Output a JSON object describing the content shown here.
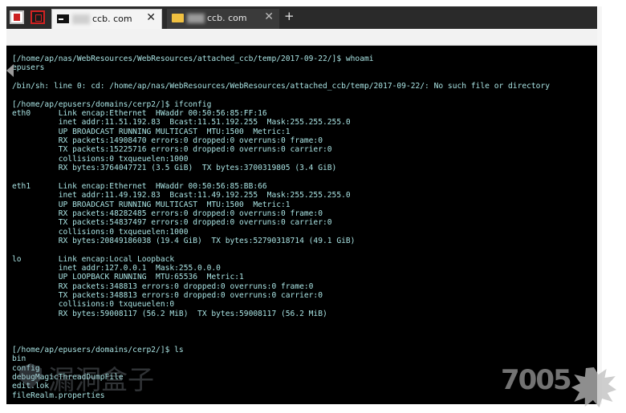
{
  "tabs": [
    {
      "domain": "ccb. com",
      "close": "✕",
      "active": true
    },
    {
      "domain": "ccb. com",
      "close": "✕",
      "active": false
    }
  ],
  "new_tab": "+",
  "terminal": {
    "lines": [
      "[/home/ap/nas/WebResources/WebResources/attached_ccb/temp/2017-09-22/]$ whoami",
      "epusers",
      "",
      "/bin/sh: line 0: cd: /home/ap/nas/WebResources/WebResources/attached_ccb/temp/2017-09-22/: No such file or directory",
      "",
      "[/home/ap/epusers/domains/cerp2/]$ ifconfig",
      "eth0      Link encap:Ethernet  HWaddr 00:50:56:85:FF:16",
      "          inet addr:11.51.192.83  Bcast:11.51.192.255  Mask:255.255.255.0",
      "          UP BROADCAST RUNNING MULTICAST  MTU:1500  Metric:1",
      "          RX packets:14908470 errors:0 dropped:0 overruns:0 frame:0",
      "          TX packets:15225716 errors:0 dropped:0 overruns:0 carrier:0",
      "          collisions:0 txqueuelen:1000",
      "          RX bytes:3764047721 (3.5 GiB)  TX bytes:3700319805 (3.4 GiB)",
      "",
      "eth1      Link encap:Ethernet  HWaddr 00:50:56:85:BB:66",
      "          inet addr:11.49.192.83  Bcast:11.49.192.255  Mask:255.255.255.0",
      "          UP BROADCAST RUNNING MULTICAST  MTU:1500  Metric:1",
      "          RX packets:48282485 errors:0 dropped:0 overruns:0 frame:0",
      "          TX packets:54837497 errors:0 dropped:0 overruns:0 carrier:0",
      "          collisions:0 txqueuelen:1000",
      "          RX bytes:20849186038 (19.4 GiB)  TX bytes:52790318714 (49.1 GiB)",
      "",
      "lo        Link encap:Local Loopback",
      "          inet addr:127.0.0.1  Mask:255.0.0.0",
      "          UP LOOPBACK RUNNING  MTU:65536  Metric:1",
      "          RX packets:348813 errors:0 dropped:0 overruns:0 frame:0",
      "          TX packets:348813 errors:0 dropped:0 overruns:0 carrier:0",
      "          collisions:0 txqueuelen:0",
      "          RX bytes:59008117 (56.2 MiB)  TX bytes:59008117 (56.2 MiB)",
      "",
      "",
      "",
      "[/home/ap/epusers/domains/cerp2/]$ ls",
      "bin",
      "config",
      "debugMagicThreadDumpFile",
      "edit.lok",
      "fileRealm.properties"
    ]
  },
  "watermarks": {
    "left": "漏洞盒子",
    "right": "7005"
  },
  "colors": {
    "terminal_bg": "#000000",
    "terminal_fg": "#a9e3e3",
    "window_controls": "#d32222",
    "tabbar": "#2a2a2a"
  }
}
